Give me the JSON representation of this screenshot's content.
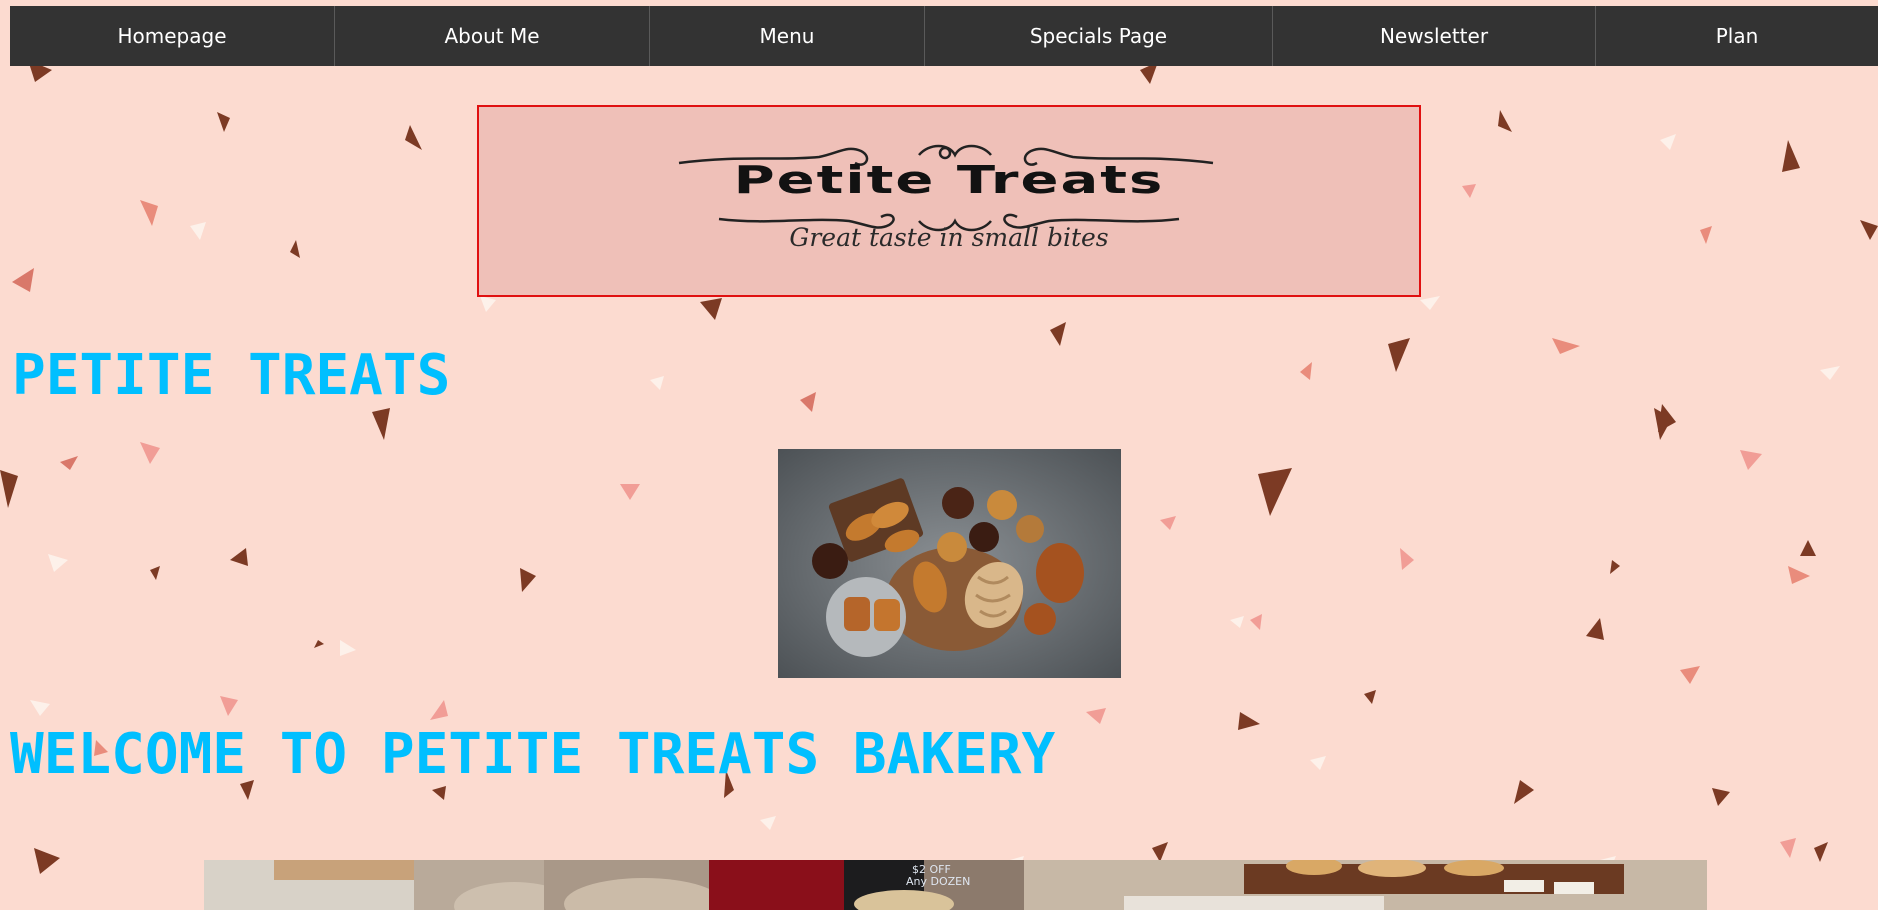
{
  "nav": {
    "items": [
      {
        "label": "Homepage"
      },
      {
        "label": "About Me"
      },
      {
        "label": "Menu"
      },
      {
        "label": "Specials Page"
      },
      {
        "label": "Newsletter"
      },
      {
        "label": "Plan"
      }
    ]
  },
  "logo": {
    "title": "Petite Treats",
    "tagline": "Great taste in small bites"
  },
  "main": {
    "title": "PETITE TREATS",
    "welcome": "WELCOME TO PETITE TREATS BAKERY"
  },
  "bakery_sign": {
    "price_line1": "$2 OFF",
    "price_line2": "Any DOZEN"
  },
  "colors": {
    "background": "#fcdbd0",
    "nav_background": "#333333",
    "heading": "#00bfff",
    "logo_border": "#e01010",
    "logo_background": "#efc0b8"
  }
}
